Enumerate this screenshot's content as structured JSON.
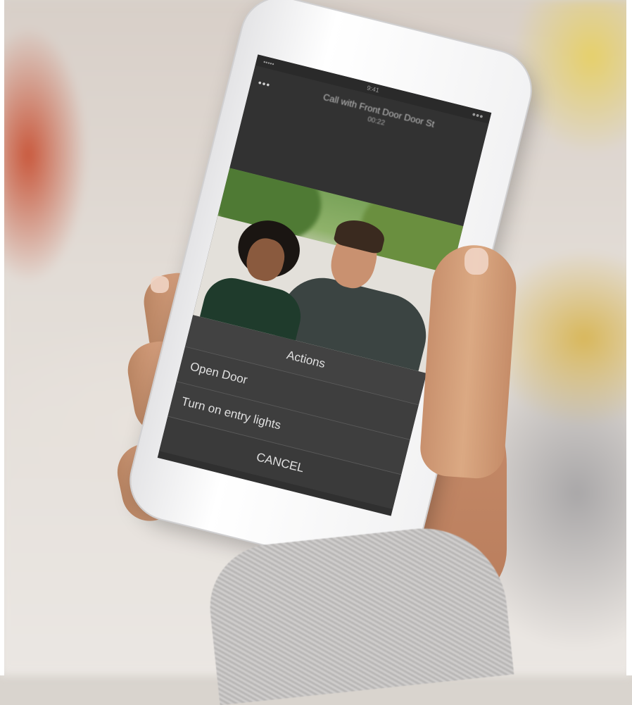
{
  "status_bar": {
    "left": "•••••",
    "time": "9:41",
    "right": "●●●"
  },
  "call": {
    "more_icon": "•••",
    "title": "Call with Front Door Door St",
    "timer": "00:22"
  },
  "actions_sheet": {
    "title": "Actions",
    "items": [
      {
        "label": "Open Door"
      },
      {
        "label": "Turn on entry lights"
      }
    ],
    "cancel_label": "CANCEL"
  }
}
